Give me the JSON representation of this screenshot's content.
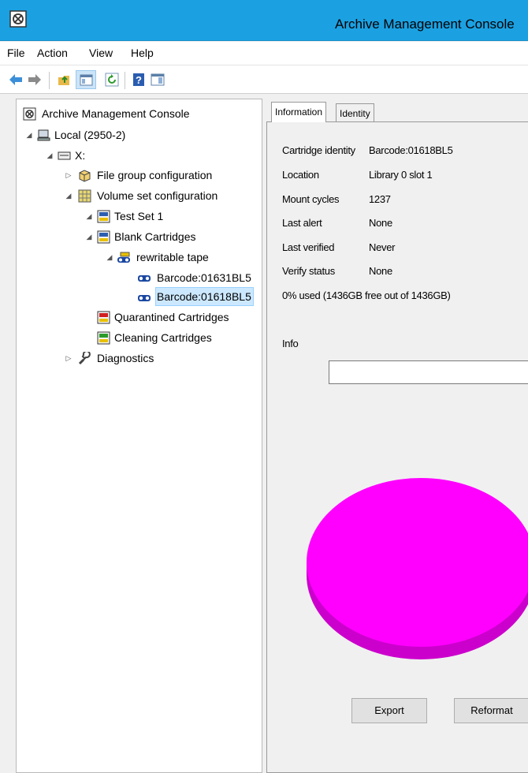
{
  "window": {
    "title": "Archive Management Console"
  },
  "menu": {
    "file": "File",
    "action": "Action",
    "view": "View",
    "help": "Help"
  },
  "toolbar": {
    "icons": [
      "back-arrow-icon",
      "forward-arrow-icon",
      "up-folder-icon",
      "show-hide-tree-icon",
      "refresh-icon",
      "help-icon",
      "show-action-pane-icon"
    ]
  },
  "tree": {
    "root": "Archive Management Console",
    "local": "Local (2950-2)",
    "drive": "X:",
    "file_group": "File group configuration",
    "volume_set": "Volume set configuration",
    "test_set": "Test Set 1",
    "blank": "Blank Cartridges",
    "rewritable": "rewritable tape",
    "barcode1": "Barcode:01631BL5",
    "barcode2": "Barcode:01618BL5",
    "quarantined": "Quarantined Cartridges",
    "cleaning": "Cleaning Cartridges",
    "diagnostics": "Diagnostics"
  },
  "tabs": {
    "information": "Information",
    "identity": "Identity"
  },
  "details": {
    "cartridge_identity_label": "Cartridge identity",
    "cartridge_identity_value": "Barcode:01618BL5",
    "location_label": "Location",
    "location_value": "Library 0 slot 1",
    "mount_cycles_label": "Mount cycles",
    "mount_cycles_value": "1237",
    "last_alert_label": "Last alert",
    "last_alert_value": "None",
    "last_verified_label": "Last verified",
    "last_verified_value": "Never",
    "verify_status_label": "Verify status",
    "verify_status_value": "None",
    "usage": "0% used (1436GB free out of 1436GB)",
    "info_label": "Info",
    "info_value": ""
  },
  "usage_chart": {
    "used_percent": 0,
    "free_color": "#ff00ff",
    "free_side_color": "#cc00cc"
  },
  "buttons": {
    "export": "Export",
    "reformat": "Reformat"
  },
  "colors": {
    "titlebar": "#1ba1e2",
    "selection": "#cce8ff"
  }
}
